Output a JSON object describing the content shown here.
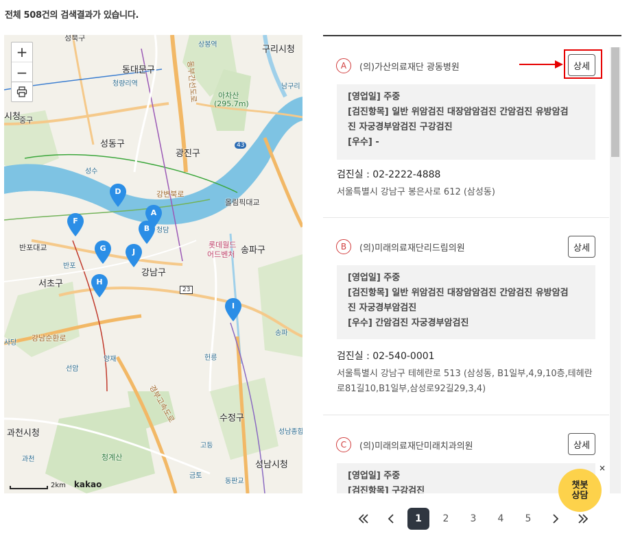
{
  "summary": "전체 508건의 검색결과가 있습니다.",
  "map": {
    "zoom_in": "+",
    "zoom_out": "−",
    "scale_text": "2km",
    "provider": "kakao",
    "labels": {
      "seongbuk": "성북구",
      "dongdaemun": "동대문구",
      "cheongnyangni": "청량리역",
      "sangbong": "상봉역",
      "guri": "구리시청",
      "jung": "중구",
      "sicheong": "시청",
      "achasan": "아차산",
      "achasan_h": "(295.7m)",
      "seongdong": "성동구",
      "gwangjin": "광진구",
      "namguri": "남구리",
      "seongsu": "성수",
      "olympic": "올림픽대교",
      "banpo_bridge": "반포대교",
      "banpo": "반포",
      "lotte": "롯데월드",
      "adventure": "어드벤처",
      "songpa": "송파구",
      "seocho": "서초구",
      "gangnam": "강남구",
      "sadang": "사당",
      "yangjae": "양재",
      "seonam": "선암",
      "hyeonreung": "헌릉",
      "sujeong": "수정구",
      "gwacheon_hall": "과천시청",
      "cheonggye": "청계산",
      "gwacheon": "과천",
      "godeung": "고등",
      "geumto": "금토",
      "dongpangyo": "동판교",
      "seongnam": "성남시청",
      "seongnam_sports": "성남종합운동장",
      "songpa_ic": "송파",
      "cheongdam": "청담",
      "gangbyeon": "강변북로",
      "olympic_ro": "올림픽대로",
      "gangnamsunhwan": "강남순환로",
      "gyeongbu": "경부고속도로",
      "dongbu": "동부간선도로",
      "route43": "43",
      "route23": "23"
    },
    "markers": [
      {
        "letter": "D",
        "color": "#1e88e5"
      },
      {
        "letter": "A",
        "color": "#1e88e5"
      },
      {
        "letter": "B",
        "color": "#1e88e5"
      },
      {
        "letter": "F",
        "color": "#1e88e5"
      },
      {
        "letter": "G",
        "color": "#1e88e5"
      },
      {
        "letter": "J",
        "color": "#1e88e5"
      },
      {
        "letter": "H",
        "color": "#1e88e5"
      },
      {
        "letter": "I",
        "color": "#1e88e5"
      }
    ]
  },
  "results": [
    {
      "badge": "A",
      "name": "(의)가산의료재단 광동병원",
      "detail_label": "상세",
      "info": [
        "[영업일] 주중",
        "[검진항목] 일반 위암검진 대장암암검진 간암검진 유방암검",
        "진 자궁경부암검진 구강검진",
        "[우수] -"
      ],
      "phone_label": "검진실 :",
      "phone": "02-2222-4888",
      "address": "서울특별시 강남구 봉은사로 612 (삼성동)"
    },
    {
      "badge": "B",
      "name": "(의)미래의료재단리드림의원",
      "detail_label": "상세",
      "info": [
        "[영업일] 주중",
        "[검진항목] 일반 위암검진 대장암암검진 간암검진 유방암검",
        "진 자궁경부암검진",
        "[우수] 간암검진 자궁경부암검진"
      ],
      "phone_label": "검진실 :",
      "phone": "02-540-0001",
      "address": "서울특별시 강남구 테헤란로 513 (삼성동, B1일부,4,9,10층,테헤란로81길10,B1일부,삼성로92길29,3,4)"
    },
    {
      "badge": "C",
      "name": "(의)미래의료재단미래치과의원",
      "detail_label": "상세",
      "info": [
        "[영업일] 주중",
        "[검진항목] 구강검진"
      ],
      "phone_label": "",
      "phone": "",
      "address": ""
    }
  ],
  "chatbot": {
    "line1": "챗봇",
    "line2": "상담",
    "close": "×"
  },
  "pagination": {
    "first": "«",
    "prev": "‹",
    "pages": [
      "1",
      "2",
      "3",
      "4",
      "5"
    ],
    "current": "1",
    "next": "›",
    "last": "»"
  }
}
